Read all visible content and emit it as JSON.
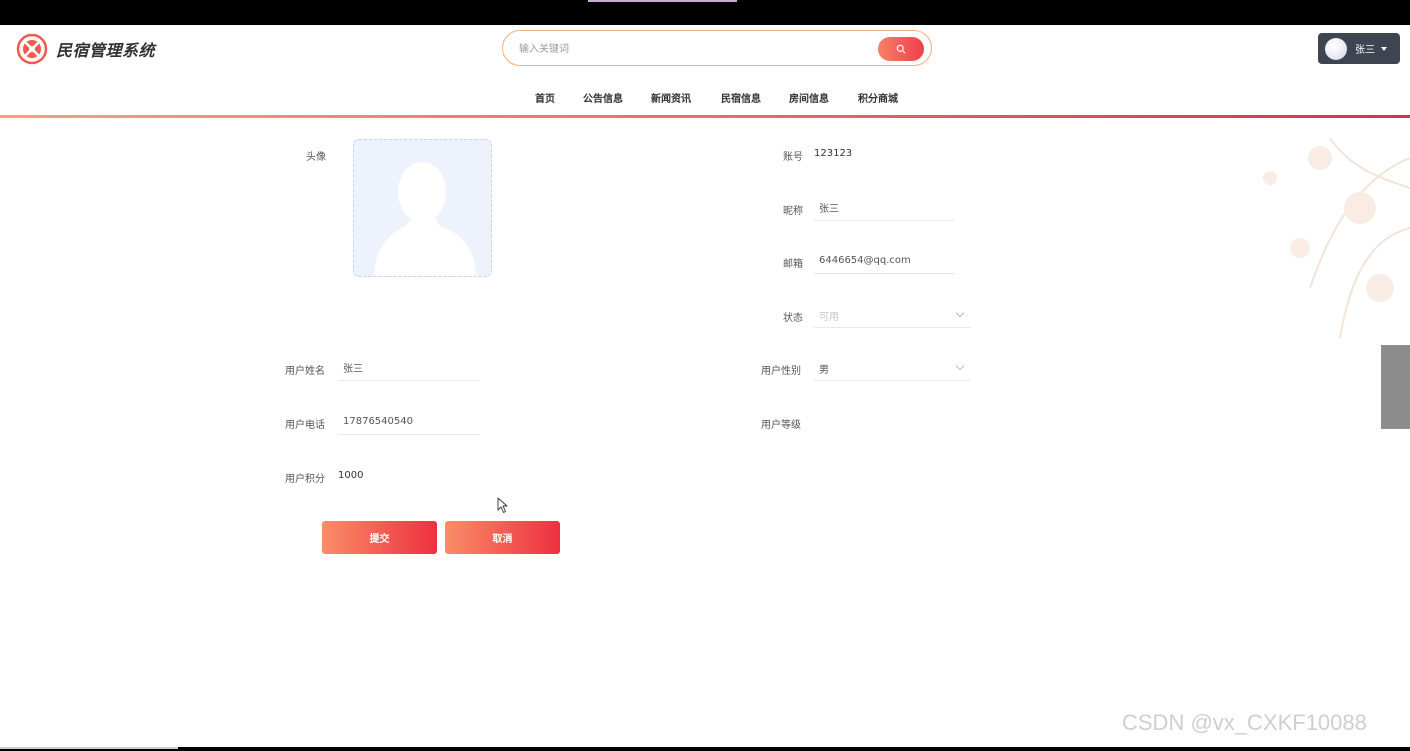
{
  "app": {
    "title": "民宿管理系统"
  },
  "search": {
    "placeholder": "输入关键词"
  },
  "user": {
    "name": "张三"
  },
  "nav": {
    "items": [
      "首页",
      "公告信息",
      "新闻资讯",
      "民宿信息",
      "房间信息",
      "积分商城"
    ]
  },
  "form": {
    "avatar_label": "头像",
    "account_label": "账号",
    "account_value": "123123",
    "nickname_label": "昵称",
    "nickname_value": "张三",
    "email_label": "邮箱",
    "email_value": "6446654@qq.com",
    "status_label": "状态",
    "status_value": "可用",
    "realname_label": "用户姓名",
    "realname_value": "张三",
    "gender_label": "用户性别",
    "gender_value": "男",
    "phone_label": "用户电话",
    "phone_value": "17876540540",
    "level_label": "用户等级",
    "points_label": "用户积分",
    "points_value": "1000",
    "submit_label": "提交",
    "cancel_label": "取消"
  },
  "watermark": "CSDN @vx_CXKF10088",
  "colors": {
    "accent": "#ef3e4a",
    "accent_light": "#fa8d67",
    "user_menu_bg": "#3f4451"
  }
}
